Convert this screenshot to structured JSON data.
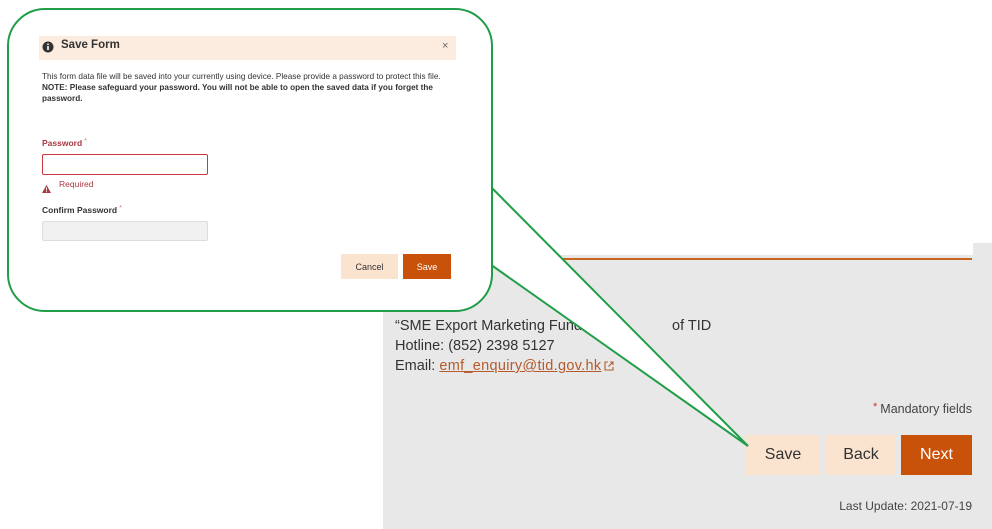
{
  "modal": {
    "title": "Save Form",
    "close": "×",
    "body_text": "This form data file will be saved into your currently using device. Please provide a password to protect this file.",
    "note": "NOTE: Please safeguard your password. You will not be able to open the saved data if you forget the password.",
    "password_label": "Password",
    "required_marker": "*",
    "password_error": "Required",
    "confirm_label": "Confirm Password",
    "cancel_label": "Cancel",
    "save_label": "Save"
  },
  "page": {
    "contact_line1_start": "“SME Export Marketing Fund",
    "contact_line1_end": "of TID",
    "hotline": "Hotline: (852) 2398 5127",
    "email_label": "Email:",
    "email": "emf_enquiry@tid.gov.hk",
    "mandatory_marker": "*",
    "mandatory_text": "Mandatory fields",
    "save_label": "Save",
    "back_label": "Back",
    "next_label": "Next",
    "last_update": "Last Update: 2021-07-19"
  },
  "colors": {
    "accent": "#c9520a",
    "callout_green": "#1f9e47",
    "light_button": "#fbe4cf",
    "error_red": "#a8373f"
  }
}
